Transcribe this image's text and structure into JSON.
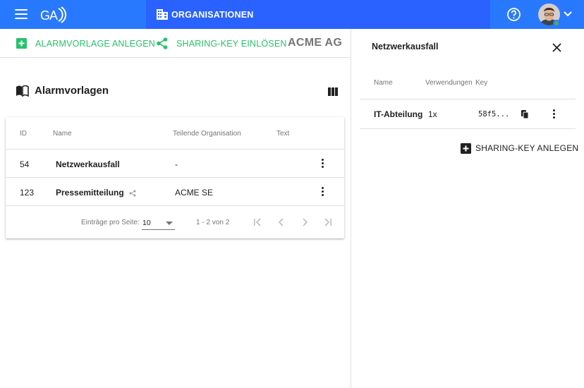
{
  "topbar": {
    "org_label": "ORGANISATIONEN",
    "icons": {
      "menu": "menu-icon",
      "logo": "ga-logo",
      "org": "building-icon",
      "help": "help-icon",
      "expand": "chevron-down-icon"
    },
    "brand_color": "#2979ff"
  },
  "actions": {
    "create_template": "ALARMVORLAGE ANLEGEN",
    "redeem_key": "SHARING-KEY EINLÖSEN",
    "org_name": "ACME AG",
    "accent_color": "#27c26a"
  },
  "templates": {
    "title": "Alarmvorlagen",
    "columns": [
      "ID",
      "Name",
      "Teilende Organisation",
      "Text"
    ],
    "rows": [
      {
        "id": "54",
        "name": "Netzwerkausfall",
        "org": "-",
        "text": "",
        "shared": false
      },
      {
        "id": "123",
        "name": "Pressemitteilung",
        "org": "ACME SE",
        "text": "",
        "shared": true
      }
    ],
    "pager": {
      "per_page_label": "Einträge pro Seite:",
      "per_page": "10",
      "range": "1 - 2 von 2"
    }
  },
  "detail": {
    "title": "Netzwerkausfall",
    "columns": [
      "Name",
      "Verwendungen",
      "Key"
    ],
    "rows": [
      {
        "name": "IT-Abteilung",
        "uses": "1x",
        "key": "58f5..."
      }
    ],
    "create_key_label": "SHARING-KEY ANLEGEN"
  }
}
